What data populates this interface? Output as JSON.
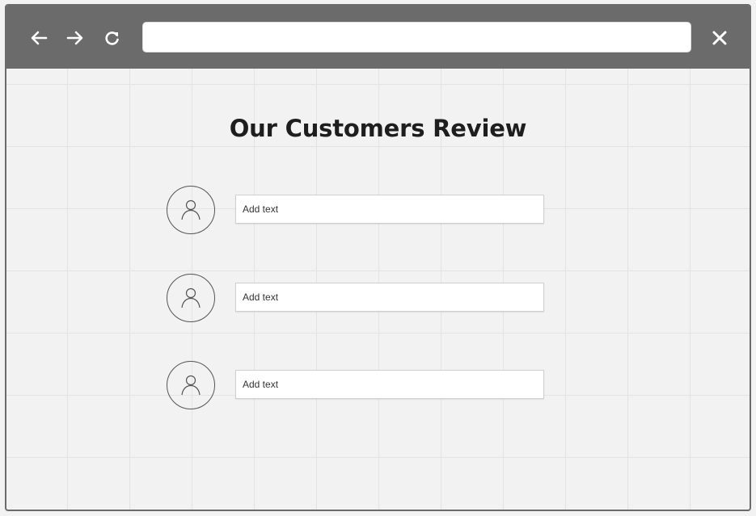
{
  "browser": {
    "back_icon": "arrow-left-icon",
    "forward_icon": "arrow-right-icon",
    "reload_icon": "reload-icon",
    "close_icon": "close-icon",
    "address_value": ""
  },
  "page": {
    "title": "Our Customers Review"
  },
  "reviews": [
    {
      "avatar_icon": "user-icon",
      "placeholder": "Add text"
    },
    {
      "avatar_icon": "user-icon",
      "placeholder": "Add text"
    },
    {
      "avatar_icon": "user-icon",
      "placeholder": "Add text"
    }
  ],
  "colors": {
    "toolbar": "#6b6b6b",
    "background": "#f2f2f2",
    "title_text": "#1e1e1e"
  }
}
